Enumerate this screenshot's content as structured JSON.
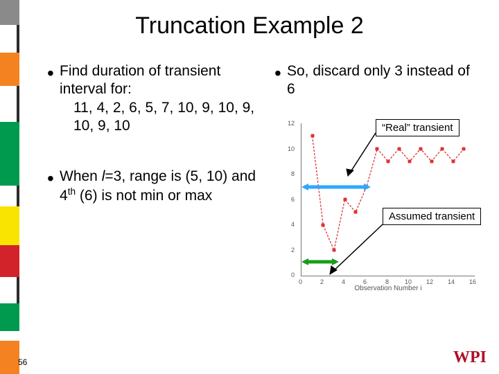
{
  "title": "Truncation Example 2",
  "bullets": {
    "left1": "Find duration of transient interval for:",
    "left1_data": "11, 4, 2, 6, 5, 7, 10, 9, 10, 9, 10, 9, 10",
    "left2_a": "When ",
    "left2_b": "l",
    "left2_c": "=3, range is (5, 10) and 4",
    "left2_ord": "th",
    "left2_d": " (6) is not min or max",
    "right1": "So, discard only 3 instead of 6"
  },
  "callouts": {
    "real": "“Real” transient",
    "assumed": "Assumed transient"
  },
  "footer": {
    "page": "56",
    "logo": "WPI"
  },
  "chart_data": {
    "type": "line",
    "x": [
      1,
      2,
      3,
      4,
      5,
      6,
      7,
      8,
      9,
      10,
      11,
      12,
      13,
      14,
      15
    ],
    "values": [
      11,
      4,
      2,
      6,
      5,
      7,
      10,
      9,
      10,
      9,
      10,
      9,
      10,
      9,
      10
    ],
    "xlabel": "Observation Number i",
    "ylabel": "",
    "xlim": [
      0,
      16
    ],
    "ylim": [
      0,
      12
    ],
    "ticks_y": [
      0,
      2,
      4,
      6,
      8,
      10,
      12
    ],
    "ticks_x": [
      0,
      2,
      4,
      6,
      8,
      10,
      12,
      14,
      16
    ]
  }
}
